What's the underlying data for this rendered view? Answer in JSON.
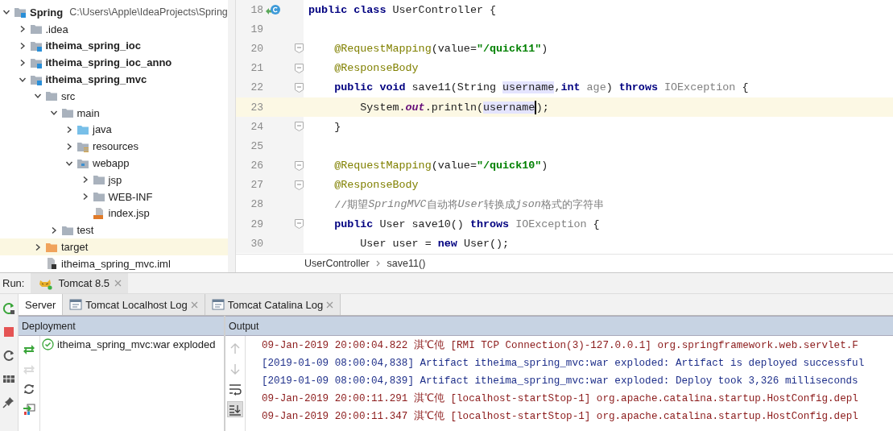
{
  "project_tree": {
    "items": [
      {
        "label": "Spring",
        "kind": "module",
        "bold": true,
        "detail": "C:\\Users\\Apple\\IdeaProjects\\Spring",
        "expanded": true,
        "selected": false,
        "children": [
          {
            "label": ".idea",
            "kind": "folder",
            "bold": false,
            "expanded": false,
            "selected": false
          },
          {
            "label": "itheima_spring_ioc",
            "kind": "module",
            "bold": true,
            "expanded": false,
            "selected": false
          },
          {
            "label": "itheima_spring_ioc_anno",
            "kind": "module",
            "bold": true,
            "expanded": false,
            "selected": false
          },
          {
            "label": "itheima_spring_mvc",
            "kind": "module",
            "bold": true,
            "expanded": true,
            "selected": false,
            "children": [
              {
                "label": "src",
                "kind": "folder",
                "bold": false,
                "expanded": true,
                "selected": false,
                "children": [
                  {
                    "label": "main",
                    "kind": "folder",
                    "bold": false,
                    "expanded": true,
                    "selected": false,
                    "children": [
                      {
                        "label": "java",
                        "kind": "source-folder",
                        "bold": false,
                        "expanded": false,
                        "selected": false
                      },
                      {
                        "label": "resources",
                        "kind": "resources-folder",
                        "bold": false,
                        "expanded": false,
                        "selected": false
                      },
                      {
                        "label": "webapp",
                        "kind": "web-folder",
                        "bold": false,
                        "expanded": true,
                        "selected": false,
                        "children": [
                          {
                            "label": "jsp",
                            "kind": "folder",
                            "bold": false,
                            "expanded": false,
                            "selected": false
                          },
                          {
                            "label": "WEB-INF",
                            "kind": "folder",
                            "bold": false,
                            "expanded": false,
                            "selected": false
                          },
                          {
                            "label": "index.jsp",
                            "kind": "jsp-file",
                            "bold": false,
                            "selected": false
                          }
                        ]
                      }
                    ]
                  },
                  {
                    "label": "test",
                    "kind": "folder",
                    "bold": false,
                    "expanded": false,
                    "selected": false
                  }
                ]
              },
              {
                "label": "target",
                "kind": "excluded-folder",
                "bold": false,
                "expanded": false,
                "selected": true
              },
              {
                "label": "itheima_spring_mvc.iml",
                "kind": "iml-file",
                "bold": false,
                "selected": false
              }
            ]
          }
        ]
      }
    ]
  },
  "editor": {
    "lines": [
      {
        "number": "18",
        "kind": "class",
        "fold": false,
        "current": false,
        "segments": [
          {
            "kind": "keyword",
            "text": "public class "
          },
          {
            "kind": "plain",
            "text": "UserController {"
          }
        ]
      },
      {
        "number": "19",
        "kind": "code",
        "fold": false,
        "current": false
      },
      {
        "number": "20",
        "kind": "code",
        "fold": true,
        "current": false,
        "segments": [
          {
            "kind": "annotation",
            "text": "    @RequestMapping"
          },
          {
            "kind": "plain",
            "text": "(value="
          },
          {
            "kind": "string",
            "text": "\"/quick11\""
          },
          {
            "kind": "plain",
            "text": ")"
          }
        ]
      },
      {
        "number": "21",
        "kind": "code",
        "fold": true,
        "current": false,
        "segments": [
          {
            "kind": "annotation",
            "text": "    @ResponseBody"
          }
        ]
      },
      {
        "number": "22",
        "kind": "code",
        "fold": true,
        "current": false,
        "segments": [
          {
            "kind": "keyword",
            "text": "    public void "
          },
          {
            "kind": "plain",
            "text": "save11(String "
          },
          {
            "kind": "ref",
            "text": "username"
          },
          {
            "kind": "plain",
            "text": ","
          },
          {
            "kind": "keyword",
            "text": "int "
          },
          {
            "kind": "unused",
            "text": "age"
          },
          {
            "kind": "plain",
            "text": ") "
          },
          {
            "kind": "keyword",
            "text": "throws "
          },
          {
            "kind": "unused",
            "text": "IOException"
          },
          {
            "kind": "plain",
            "text": " {"
          }
        ]
      },
      {
        "number": "23",
        "kind": "code",
        "fold": false,
        "current": true,
        "segments": [
          {
            "kind": "plain",
            "text": "        System."
          },
          {
            "kind": "field",
            "text": "out"
          },
          {
            "kind": "plain",
            "text": ".println("
          },
          {
            "kind": "ref",
            "text": "username",
            "caret": true
          },
          {
            "kind": "plain",
            "text": ");"
          }
        ]
      },
      {
        "number": "24",
        "kind": "code",
        "fold": true,
        "current": false,
        "segments": [
          {
            "kind": "plain",
            "text": "    }"
          }
        ]
      },
      {
        "number": "25",
        "kind": "code",
        "fold": false,
        "current": false
      },
      {
        "number": "26",
        "kind": "code",
        "fold": true,
        "current": false,
        "segments": [
          {
            "kind": "annotation",
            "text": "    @RequestMapping"
          },
          {
            "kind": "plain",
            "text": "(value="
          },
          {
            "kind": "string",
            "text": "\"/quick10\""
          },
          {
            "kind": "plain",
            "text": ")"
          }
        ]
      },
      {
        "number": "27",
        "kind": "code",
        "fold": true,
        "current": false,
        "segments": [
          {
            "kind": "annotation",
            "text": "    @ResponseBody"
          }
        ]
      },
      {
        "number": "28",
        "kind": "code",
        "fold": false,
        "current": false,
        "segments": [
          {
            "kind": "comment",
            "text": "    //期望"
          },
          {
            "kind": "comment-italic",
            "text": "SpringMVC"
          },
          {
            "kind": "comment",
            "text": "自动将"
          },
          {
            "kind": "comment-italic",
            "text": "User"
          },
          {
            "kind": "comment",
            "text": "转换成"
          },
          {
            "kind": "comment-italic",
            "text": "json"
          },
          {
            "kind": "comment",
            "text": "格式的字符串"
          }
        ]
      },
      {
        "number": "29",
        "kind": "code",
        "fold": true,
        "current": false,
        "segments": [
          {
            "kind": "keyword",
            "text": "    public "
          },
          {
            "kind": "plain",
            "text": "User save10() "
          },
          {
            "kind": "keyword",
            "text": "throws "
          },
          {
            "kind": "unused",
            "text": "IOException"
          },
          {
            "kind": "plain",
            "text": " {"
          }
        ]
      },
      {
        "number": "30",
        "kind": "code",
        "fold": false,
        "current": false,
        "segments": [
          {
            "kind": "plain",
            "text": "        User user = "
          },
          {
            "kind": "keyword",
            "text": "new "
          },
          {
            "kind": "plain",
            "text": "User();"
          }
        ]
      }
    ],
    "breadcrumb": [
      "UserController",
      "save11()"
    ]
  },
  "run": {
    "label": "Run:",
    "tabs": [
      {
        "label": "Tomcat 8.5",
        "selected": true
      }
    ],
    "toolbar": [
      {
        "kind": "rerun"
      },
      {
        "kind": "stop"
      },
      {
        "kind": "restart"
      },
      {
        "kind": "layout"
      },
      {
        "kind": "pin"
      }
    ],
    "subtabs": [
      {
        "label": "Server",
        "kind": "plain",
        "selected": true
      },
      {
        "label": "Tomcat Localhost Log",
        "kind": "log",
        "selected": false
      },
      {
        "label": "Tomcat Catalina Log",
        "kind": "log",
        "selected": false
      }
    ],
    "deployment": {
      "header": "Deployment",
      "toolbar": [
        {
          "kind": "deploy",
          "disabled": false
        },
        {
          "kind": "undeploy",
          "disabled": true
        },
        {
          "kind": "refresh",
          "disabled": false
        },
        {
          "kind": "deploy-all",
          "disabled": false
        }
      ],
      "items": [
        {
          "label": "itheima_spring_mvc:war exploded",
          "kind": "deployed"
        }
      ]
    },
    "output": {
      "header": "Output",
      "toolbar": [
        {
          "kind": "up",
          "disabled": true,
          "selected": false
        },
        {
          "kind": "down",
          "disabled": true,
          "selected": false
        },
        {
          "kind": "wrap",
          "disabled": false,
          "selected": false
        },
        {
          "kind": "scroll-end",
          "disabled": false,
          "selected": true
        }
      ],
      "lines": [
        {
          "kind": "stderr",
          "text": "09-Jan-2019 20:00:04.822 淇℃伅 [RMI TCP Connection(3)-127.0.0.1] org.springframework.web.servlet.F"
        },
        {
          "kind": "stdout",
          "text": "[2019-01-09 08:00:04,838] Artifact itheima_spring_mvc:war exploded: Artifact is deployed successful"
        },
        {
          "kind": "stdout",
          "text": "[2019-01-09 08:00:04,839] Artifact itheima_spring_mvc:war exploded: Deploy took 3,326 milliseconds"
        },
        {
          "kind": "stderr",
          "text": "09-Jan-2019 20:00:11.291 淇℃伅 [localhost-startStop-1] org.apache.catalina.startup.HostConfig.depl"
        },
        {
          "kind": "stderr",
          "text": "09-Jan-2019 20:00:11.347 淇℃伅 [localhost-startStop-1] org.apache.catalina.startup.HostConfig.depl"
        }
      ]
    }
  }
}
